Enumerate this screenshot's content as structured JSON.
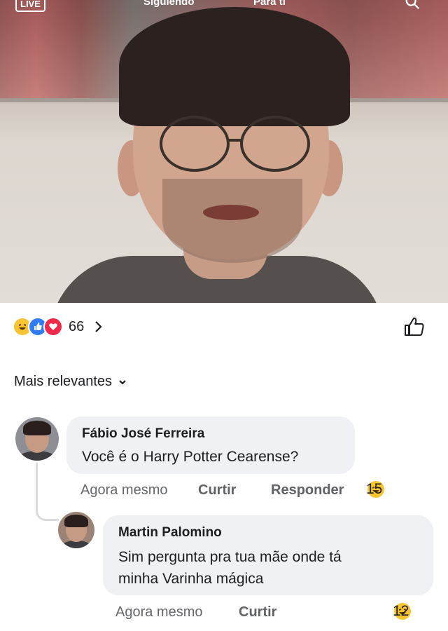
{
  "video": {
    "top_tabs": {
      "live": "LIVE",
      "following": "Siguiendo",
      "for_you": "Para ti"
    },
    "icon": "search-icon"
  },
  "reactions": {
    "icons": [
      "haha-reaction-icon",
      "like-reaction-icon",
      "love-reaction-icon"
    ],
    "count": "66",
    "like_icon": "thumbs-up-icon"
  },
  "sort": {
    "label": "Mais relevantes"
  },
  "comments": [
    {
      "author": "Fábio José Ferreira",
      "text": "Você é o Harry Potter Cearense?",
      "time": "Agora mesmo",
      "like_label": "Curtir",
      "reply_label": "Responder",
      "reactions": "15"
    },
    {
      "author": "Martin Palomino",
      "text_line1": "Sim pergunta pra tua mãe onde tá",
      "text_line2": "minha Varinha mágica",
      "time": "Agora mesmo",
      "like_label": "Curtir",
      "reactions": "12"
    }
  ],
  "colors": {
    "haha": "#f7c531",
    "like": "#2f7cf6",
    "love": "#f0284a",
    "bubble": "#eff1f4",
    "meta_text": "#65676b"
  }
}
